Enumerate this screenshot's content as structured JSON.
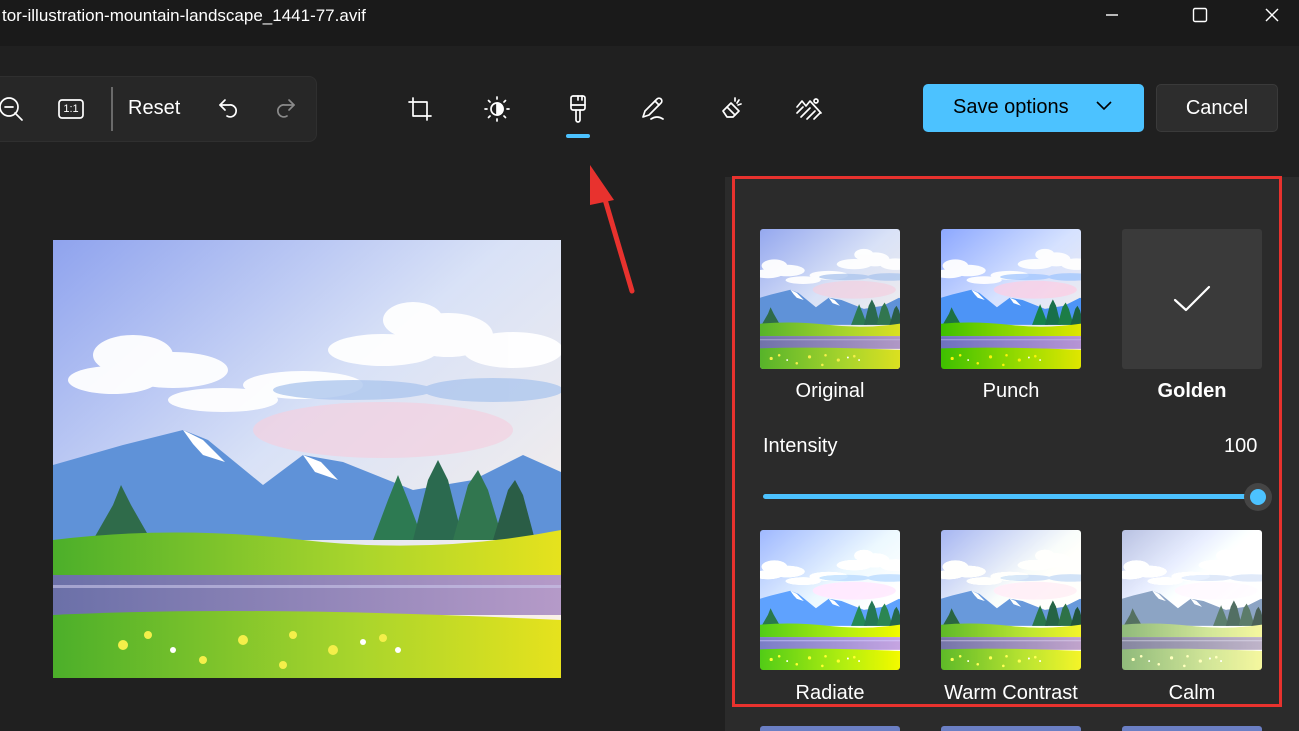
{
  "window": {
    "title": "tor-illustration-mountain-landscape_1441-77.avif",
    "controls": [
      "minimize-icon",
      "maximize-icon",
      "close-icon"
    ]
  },
  "toolbar": {
    "zoom_out_icon": "zoom-out-icon",
    "actual_size_label": "1:1",
    "reset_label": "Reset",
    "undo_icon": "undo-icon",
    "redo_icon": "redo-icon"
  },
  "tools": [
    {
      "name": "crop",
      "icon": "crop-icon"
    },
    {
      "name": "adjustment",
      "icon": "brightness-icon"
    },
    {
      "name": "filter",
      "icon": "filter-brush-icon",
      "selected": true
    },
    {
      "name": "markup",
      "icon": "pen-icon"
    },
    {
      "name": "erase",
      "icon": "eraser-icon"
    },
    {
      "name": "background",
      "icon": "background-blur-icon"
    }
  ],
  "actions": {
    "save_label": "Save options",
    "cancel_label": "Cancel"
  },
  "filters_panel": {
    "filters_row1": [
      {
        "label": "Original"
      },
      {
        "label": "Punch"
      },
      {
        "label": "Golden",
        "selected": true
      }
    ],
    "intensity_label": "Intensity",
    "intensity_value": "100",
    "intensity_fraction": 1.0,
    "filters_row2": [
      {
        "label": "Radiate"
      },
      {
        "label": "Warm Contrast"
      },
      {
        "label": "Calm"
      }
    ]
  },
  "colors": {
    "accent": "#4cc2ff",
    "annotation_red": "#e8322e",
    "background": "#202020",
    "panel": "#2b2b2b"
  }
}
